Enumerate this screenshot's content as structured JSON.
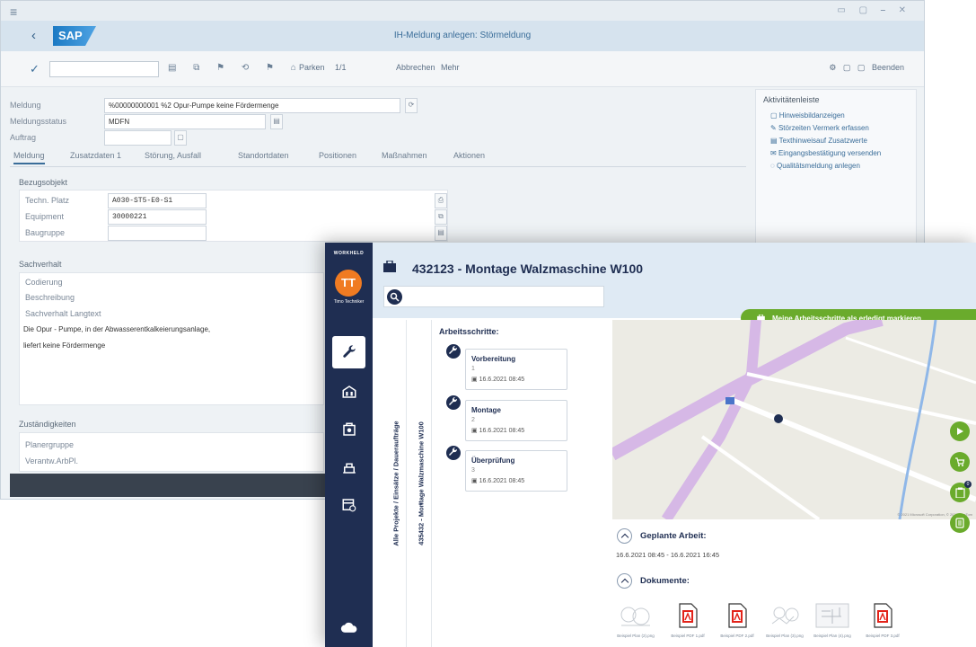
{
  "sap": {
    "title": "IH-Meldung anlegen: Störmeldung",
    "logo": "SAP",
    "toolbar": {
      "parken": "Parken",
      "pager": "1/1",
      "abbrechen": "Abbrechen",
      "mehr": "Mehr",
      "beenden": "Beenden"
    },
    "header_fields": {
      "meldung_label": "Meldung",
      "meldung_value": "%00000000001 %2 Opur-Pumpe keine Fördermenge",
      "status_label": "Meldungsstatus",
      "status_value": "MDFN",
      "auftrag_label": "Auftrag"
    },
    "tabs": [
      "Meldung",
      "Zusatzdaten 1",
      "Störung, Ausfall",
      "Standortdaten",
      "Positionen",
      "Maßnahmen",
      "Aktionen"
    ],
    "bezugsobjekt": {
      "title": "Bezugsobjekt",
      "techn_platz_label": "Techn. Platz",
      "techn_platz_value": "A030-ST5-E0-S1",
      "equipment_label": "Equipment",
      "equipment_value": "30000221",
      "baugruppe_label": "Baugruppe"
    },
    "sachverhalt": {
      "title": "Sachverhalt",
      "codierung_label": "Codierung",
      "beschreibung_label": "Beschreibung",
      "langtext_label": "Sachverhalt Langtext",
      "text_line1": "Die Opur - Pumpe, in der Abwasserentkalkeierungsanlage,",
      "text_line2": "liefert keine Fördermenge"
    },
    "zustaendigkeiten": {
      "title": "Zuständigkeiten",
      "planergruppe_label": "Planergruppe",
      "verantw_label": "Verantw.ArbPl."
    },
    "side_panel": {
      "title": "Aktivitätenleiste",
      "items": [
        "Hinweisbildanzeigen",
        "Störzeiten Vermerk erfassen",
        "Texthinweisauf Zusatzwerte",
        "Eingangsbestätigung versenden",
        "Qualitätsmeldung anlegen"
      ]
    }
  },
  "workheld": {
    "brand": "WORKHELD",
    "avatar_initials": "TT",
    "user_name": "Timo Techniker",
    "title": "432123 - Montage Walzmaschine W100",
    "search_placeholder": "",
    "done_button": "Meine Arbeitsschritte als erledigt markieren",
    "breadcrumb_all": "Alle Projekte / Einsätze / Daueraufträge",
    "breadcrumb_current": "435432 - Montage Walzmaschine W100",
    "steps_title": "Arbeitsschritte:",
    "steps": [
      {
        "name": "Vorbereitung",
        "num": "1",
        "date": "16.6.2021 08:45"
      },
      {
        "name": "Montage",
        "num": "2",
        "date": "16.6.2021 08:45"
      },
      {
        "name": "Überprüfung",
        "num": "3",
        "date": "16.6.2021 08:45"
      }
    ],
    "planned_title": "Geplante Arbeit:",
    "planned_range": "16.6.2021 08:45 - 16.6.2021 16:45",
    "docs_title": "Dokumente:",
    "docs": [
      {
        "label": "Beispiel Plan (2).png",
        "kind": "image"
      },
      {
        "label": "Beispiel PDF 1.pdf",
        "kind": "pdf"
      },
      {
        "label": "Beispiel PDF 2.pdf",
        "kind": "pdf"
      },
      {
        "label": "Beispiel Plan (3).png",
        "kind": "image"
      },
      {
        "label": "Beispiel Plan (4).png",
        "kind": "image"
      },
      {
        "label": "Beispiel PDF 3.pdf",
        "kind": "pdf"
      }
    ],
    "map_attribution": "© 2021 Microsoft Corporation, © 2021 TomTom",
    "fab_badge": "0",
    "colors": {
      "nav": "#1f2e52",
      "accent_green": "#6aab2c",
      "avatar": "#f07b22",
      "header": "#dfeaf4"
    }
  }
}
